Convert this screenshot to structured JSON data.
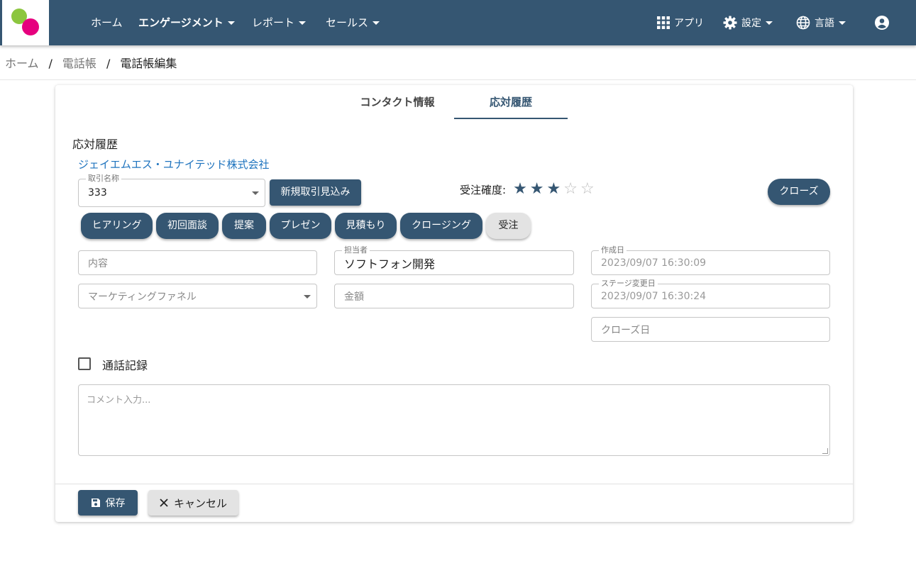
{
  "nav": {
    "items": [
      "ホーム",
      "エンゲージメント",
      "レポート",
      "セールス"
    ],
    "apps": "アプリ",
    "settings": "設定",
    "language": "言語"
  },
  "breadcrumb": {
    "home": "ホーム",
    "phonebook": "電話帳",
    "current": "電話帳編集",
    "sep": "/"
  },
  "tabs": {
    "contact": "コンタクト情報",
    "history": "応対履歴"
  },
  "section_title": "応対履歴",
  "company": "ジェイエムエス・ユナイテッド株式会社",
  "deal": {
    "label": "取引名称",
    "value": "333",
    "new_button": "新規取引見込み"
  },
  "probability": {
    "label": "受注確度:",
    "filled": 3,
    "total": 5,
    "filled_star": "★",
    "empty_star": "☆"
  },
  "close_button": "クローズ",
  "stages": [
    "ヒアリング",
    "初回面談",
    "提案",
    "プレゼン",
    "見積もり",
    "クロージング",
    "受注"
  ],
  "fields": {
    "content_placeholder": "内容",
    "funnel_placeholder": "マーケティングファネル",
    "owner_label": "担当者",
    "owner_value": "ソフトフォン開発",
    "amount_placeholder": "金額",
    "created_label": "作成日",
    "created_value": "2023/09/07 16:30:09",
    "stage_changed_label": "ステージ変更日",
    "stage_changed_value": "2023/09/07 16:30:24",
    "close_date_placeholder": "クローズ日"
  },
  "call_record_label": "通話記録",
  "comment_placeholder": "コメント入力...",
  "footer": {
    "save": "保存",
    "cancel": "キャンセル"
  },
  "colors": {
    "primary": "#355672",
    "link": "#1e73be",
    "logo_green": "#8cc63f",
    "logo_pink": "#e6007e"
  }
}
